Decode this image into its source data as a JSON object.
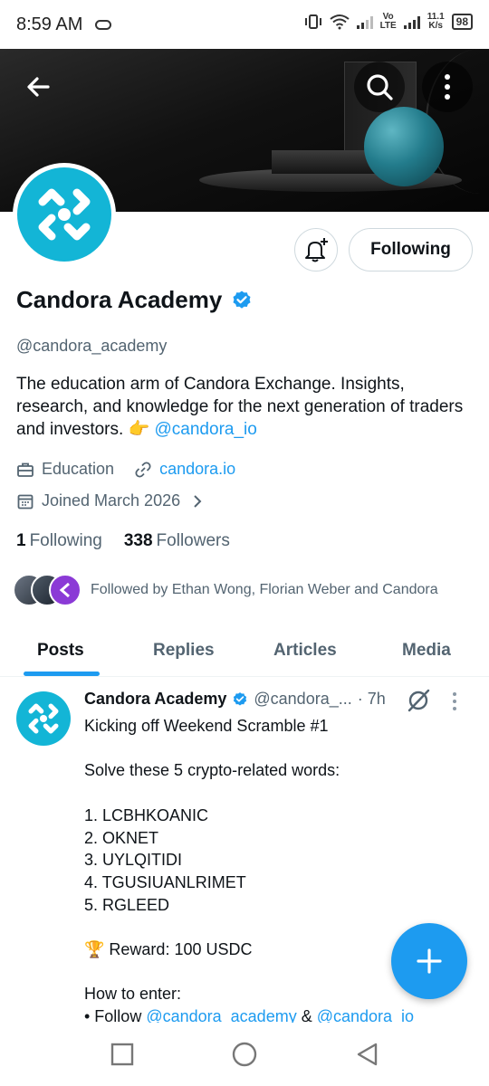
{
  "status_bar": {
    "time": "8:59 AM",
    "speed_top": "11.1",
    "speed_bottom": "K/s",
    "lte_top": "Vo",
    "lte_bottom": "LTE",
    "battery": "98"
  },
  "header": {
    "back_icon": "arrow-left",
    "search_icon": "search",
    "more_icon": "more-vertical"
  },
  "profile": {
    "name": "Candora Academy",
    "verified": true,
    "handle": "@candora_academy",
    "bio_text": "The education arm of Candora Exchange. Insights, research, and knowledge for the next generation of traders and investors. 👉 ",
    "bio_link": "@candora_io",
    "category": "Education",
    "website": "candora.io",
    "joined": "Joined March 2026",
    "following_count": "1",
    "following_label": "Following",
    "followers_count": "338",
    "followers_label": "Followers",
    "followed_by": "Followed by Ethan Wong, Florian Weber and Candora",
    "follow_button": "Following",
    "accent_color": "#1d9bf0",
    "avatar_color": "#13b5d6"
  },
  "tabs": [
    {
      "label": "Posts",
      "active": true
    },
    {
      "label": "Replies",
      "active": false
    },
    {
      "label": "Articles",
      "active": false
    },
    {
      "label": "Media",
      "active": false
    }
  ],
  "post": {
    "author": "Candora Academy",
    "handle": "@candora_...",
    "time": "· 7h",
    "text": "Kicking off Weekend Scramble #1\n\nSolve these 5 crypto-related words:\n\n1. LCBHKOANIC\n2. OKNET\n3. UYLQITIDI\n4. TGUSIUANLRIMET\n5. RGLEED\n\n🏆 Reward: 100 USDC\n\nHow to enter:",
    "last_line_prefix": "• Follow ",
    "last_line_link1": "@candora_academy",
    "last_line_mid": " & ",
    "last_line_link2": "@candora_io"
  }
}
